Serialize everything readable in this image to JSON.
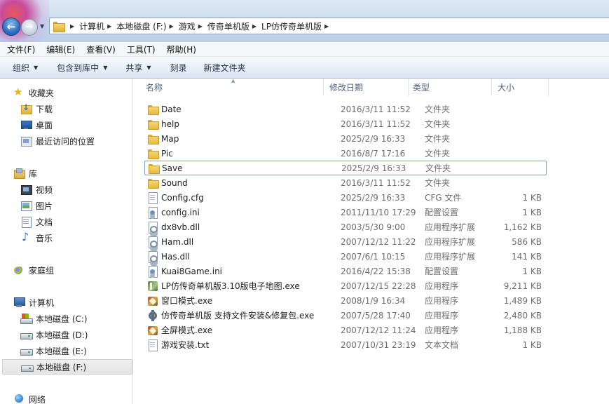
{
  "address_bar": {
    "crumbs": [
      "计算机",
      "本地磁盘 (F:)",
      "游戏",
      "传奇单机版",
      "LP仿传奇单机版"
    ]
  },
  "menu": {
    "items": [
      "文件(F)",
      "编辑(E)",
      "查看(V)",
      "工具(T)",
      "帮助(H)"
    ]
  },
  "toolbar": {
    "organize": "组织",
    "include_in_library": "包含到库中",
    "share": "共享",
    "burn": "刻录",
    "new_folder": "新建文件夹"
  },
  "nav": {
    "favorites": "收藏夹",
    "downloads": "下载",
    "desktop": "桌面",
    "recent": "最近访问的位置",
    "libraries": "库",
    "videos": "视频",
    "pictures": "图片",
    "documents": "文档",
    "music": "音乐",
    "homegroup": "家庭组",
    "computer": "计算机",
    "drive_c": "本地磁盘 (C:)",
    "drive_d": "本地磁盘 (D:)",
    "drive_e": "本地磁盘 (E:)",
    "drive_f": "本地磁盘 (F:)",
    "network": "网络"
  },
  "columns": {
    "name": "名称",
    "date": "修改日期",
    "type": "类型",
    "size": "大小"
  },
  "files": [
    {
      "name": "Date",
      "date": "2016/3/11 11:52",
      "type": "文件夹",
      "size": "",
      "icon": "folder-icon"
    },
    {
      "name": "help",
      "date": "2016/3/11 11:52",
      "type": "文件夹",
      "size": "",
      "icon": "folder-icon"
    },
    {
      "name": "Map",
      "date": "2025/2/9 16:33",
      "type": "文件夹",
      "size": "",
      "icon": "folder-icon"
    },
    {
      "name": "Pic",
      "date": "2016/8/7 17:16",
      "type": "文件夹",
      "size": "",
      "icon": "folder-icon"
    },
    {
      "name": "Save",
      "date": "2025/2/9 16:33",
      "type": "文件夹",
      "size": "",
      "icon": "folder-icon"
    },
    {
      "name": "Sound",
      "date": "2016/3/11 11:52",
      "type": "文件夹",
      "size": "",
      "icon": "folder-icon"
    },
    {
      "name": "Config.cfg",
      "date": "2025/2/9 16:33",
      "type": "CFG 文件",
      "size": "1 KB",
      "icon": "file-icon"
    },
    {
      "name": "config.ini",
      "date": "2011/11/10 17:29",
      "type": "配置设置",
      "size": "1 KB",
      "icon": "settings-file-icon"
    },
    {
      "name": "dx8vb.dll",
      "date": "2003/5/30 9:00",
      "type": "应用程序扩展",
      "size": "1,162 KB",
      "icon": "dll-file-icon"
    },
    {
      "name": "Ham.dll",
      "date": "2007/12/12 11:22",
      "type": "应用程序扩展",
      "size": "586 KB",
      "icon": "dll-file-icon"
    },
    {
      "name": "Has.dll",
      "date": "2007/6/1 10:15",
      "type": "应用程序扩展",
      "size": "141 KB",
      "icon": "dll-file-icon"
    },
    {
      "name": "Kuai8Game.ini",
      "date": "2016/4/22 15:38",
      "type": "配置设置",
      "size": "1 KB",
      "icon": "settings-file-icon"
    },
    {
      "name": "LP仿传奇单机版3.10版电子地图.exe",
      "date": "2007/12/15 22:28",
      "type": "应用程序",
      "size": "9,211 KB",
      "icon": "map-app-icon"
    },
    {
      "name": "窗口模式.exe",
      "date": "2008/1/9 16:34",
      "type": "应用程序",
      "size": "1,489 KB",
      "icon": "game-app-icon"
    },
    {
      "name": "仿传奇单机版 支持文件安装&修复包.exe",
      "date": "2007/5/28 17:40",
      "type": "应用程序",
      "size": "2,480 KB",
      "icon": "installer-app-icon"
    },
    {
      "name": "全屏模式.exe",
      "date": "2007/12/12 11:24",
      "type": "应用程序",
      "size": "1,188 KB",
      "icon": "game-app-icon"
    },
    {
      "name": "游戏安装.txt",
      "date": "2007/10/31 23:19",
      "type": "文本文档",
      "size": "1 KB",
      "icon": "text-file-icon"
    }
  ],
  "colors": {
    "selection_border": "#7da2ce",
    "header_text": "#4c607a",
    "detail_text": "#6d6d6d"
  }
}
